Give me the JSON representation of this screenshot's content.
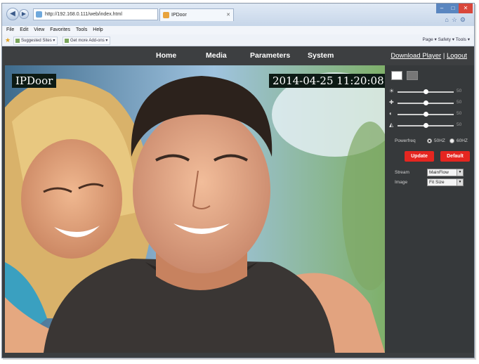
{
  "browser": {
    "address": "http://192.168.0.111/web/index.html",
    "tab_title": "IPDoor",
    "menu": [
      "File",
      "Edit",
      "View",
      "Favorites",
      "Tools",
      "Help"
    ],
    "favorites": [
      "Suggested Sites ▾",
      "Get more Add-ons ▾"
    ],
    "command_bar": "Page ▾   Safety ▾   Tools ▾"
  },
  "nav": {
    "items": [
      "Home",
      "Media",
      "Parameters",
      "System"
    ],
    "download": "Download Player",
    "separator": "|",
    "logout": "Logout"
  },
  "video": {
    "osd_name": "IPDoor",
    "osd_time": "2014-04-25 11:20:08"
  },
  "panel": {
    "sliders": [
      {
        "icon": "brightness-icon",
        "value": 50
      },
      {
        "icon": "contrast-icon",
        "value": 50
      },
      {
        "icon": "saturation-icon",
        "value": 50
      },
      {
        "icon": "sharpness-icon",
        "value": 50
      }
    ],
    "powerfreq_label": "Powerfreq",
    "option_50": "50HZ",
    "option_60": "60HZ",
    "selected_freq": "50HZ",
    "update_label": "Update",
    "default_label": "Default",
    "stream_label": "Stream",
    "stream_value": "MainFlow",
    "image_label": "Image",
    "image_value": "Fit Size"
  },
  "colors": {
    "page_bg": "#3b3e40",
    "accent_red": "#e52620"
  }
}
